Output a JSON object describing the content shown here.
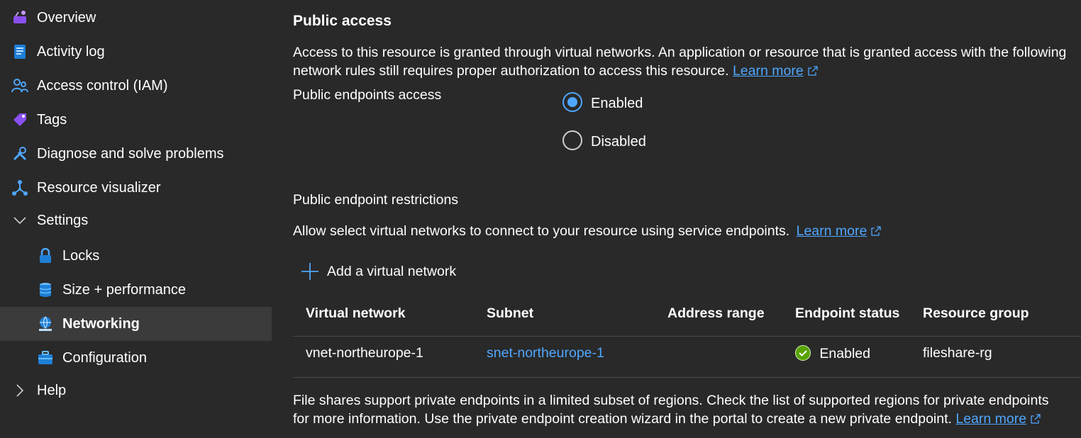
{
  "sidebar": {
    "items": [
      {
        "label": "Overview",
        "icon": "overview-icon"
      },
      {
        "label": "Activity log",
        "icon": "activity-log-icon"
      },
      {
        "label": "Access control (IAM)",
        "icon": "people-icon"
      },
      {
        "label": "Tags",
        "icon": "tag-icon"
      },
      {
        "label": "Diagnose and solve problems",
        "icon": "wrench-icon"
      },
      {
        "label": "Resource visualizer",
        "icon": "hierarchy-icon"
      },
      {
        "label": "Settings",
        "icon": "chevron-down-icon",
        "expanded": true
      },
      {
        "label": "Locks",
        "icon": "lock-icon"
      },
      {
        "label": "Size + performance",
        "icon": "database-icon"
      },
      {
        "label": "Networking",
        "icon": "networking-icon",
        "selected": true
      },
      {
        "label": "Configuration",
        "icon": "toolbox-icon"
      },
      {
        "label": "Help",
        "icon": "chevron-right-icon",
        "expanded": false
      }
    ]
  },
  "public_access": {
    "title": "Public access",
    "description": "Access to this resource is granted through virtual networks. An application or resource that is granted access with the following network rules still requires proper authorization to access this resource.",
    "learn_more": "Learn more",
    "endpoints_label": "Public endpoints access",
    "options": [
      {
        "label": "Enabled",
        "checked": true
      },
      {
        "label": "Disabled",
        "checked": false
      }
    ]
  },
  "restrictions": {
    "title": "Public endpoint restrictions",
    "description": "Allow select virtual networks to connect to your resource using service endpoints.",
    "learn_more": "Learn more",
    "add_button": "Add a virtual network"
  },
  "table": {
    "columns": [
      "Virtual network",
      "Subnet",
      "Address range",
      "Endpoint status",
      "Resource group"
    ],
    "rows": [
      {
        "virtual_network": "vnet-northeurope-1",
        "subnet": "snet-northeurope-1",
        "address_range": "",
        "endpoint_status": "Enabled",
        "resource_group": "fileshare-rg"
      }
    ]
  },
  "footer": {
    "description": "File shares support private endpoints in a limited subset of regions. Check the list of supported regions for private endpoints for more information. Use the private endpoint creation wizard in the portal to create a new private endpoint.",
    "learn_more": "Learn more"
  },
  "colors": {
    "background": "#292929",
    "selected_background": "#3b3b3b",
    "link": "#4fa7ff",
    "accent": "#4fa7ff",
    "success": "#57a300"
  }
}
